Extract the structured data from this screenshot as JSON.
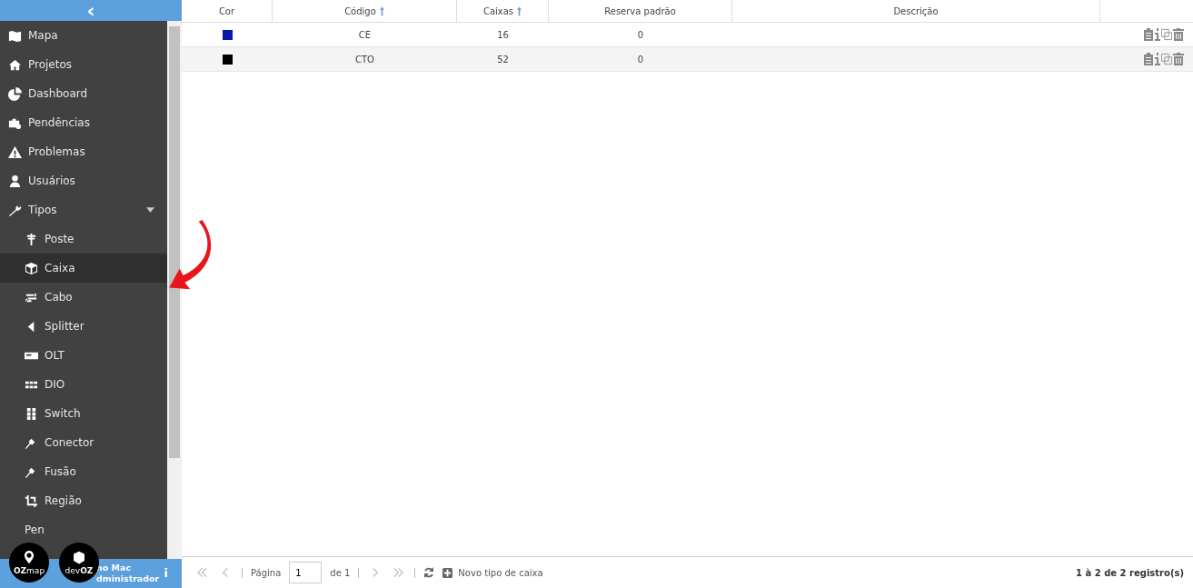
{
  "sidebar": {
    "collapse_icon": "‹",
    "items": [
      {
        "label": "Mapa",
        "selected": false
      },
      {
        "label": "Projetos",
        "selected": false
      },
      {
        "label": "Dashboard",
        "selected": false
      },
      {
        "label": "Pendências",
        "selected": false
      },
      {
        "label": "Problemas",
        "selected": false
      },
      {
        "label": "Usuários",
        "selected": false
      },
      {
        "label": "Tipos",
        "selected": false,
        "expanded": true,
        "children": [
          {
            "label": "Poste",
            "selected": false
          },
          {
            "label": "Caixa",
            "selected": true
          },
          {
            "label": "Cabo",
            "selected": false
          },
          {
            "label": "Splitter",
            "selected": false
          },
          {
            "label": "OLT",
            "selected": false
          },
          {
            "label": "DIO",
            "selected": false
          },
          {
            "label": "Switch",
            "selected": false
          },
          {
            "label": "Conector",
            "selected": false
          },
          {
            "label": "Fusão",
            "selected": false
          },
          {
            "label": "Região",
            "selected": false
          },
          {
            "label": "Pen",
            "selected": false
          }
        ]
      }
    ],
    "user_name": "no Mac",
    "user_role": "dministrador",
    "menu_icon": "i"
  },
  "table": {
    "columns": [
      {
        "label": "Cor",
        "sorted": false
      },
      {
        "label": "Código",
        "sorted": true
      },
      {
        "label": "Caixas",
        "sorted": true
      },
      {
        "label": "Reserva padrão",
        "sorted": false
      },
      {
        "label": "Descrição",
        "sorted": false
      }
    ],
    "rows": [
      {
        "color": "#0a1aa8",
        "code": "CE",
        "boxes": "16",
        "reserve": "0"
      },
      {
        "color": "#000000",
        "code": "CTO",
        "boxes": "52",
        "reserve": "0"
      }
    ]
  },
  "footer": {
    "page_label": "Página",
    "page": "1",
    "of_label": "de 1",
    "add_label": "Novo tipo de caixa",
    "summary": "1 à 2 de 2 registro(s)"
  },
  "logos": [
    {
      "name": "OZ",
      "suffix": "map"
    },
    {
      "name": "dev",
      "suffix": "OZ"
    }
  ]
}
